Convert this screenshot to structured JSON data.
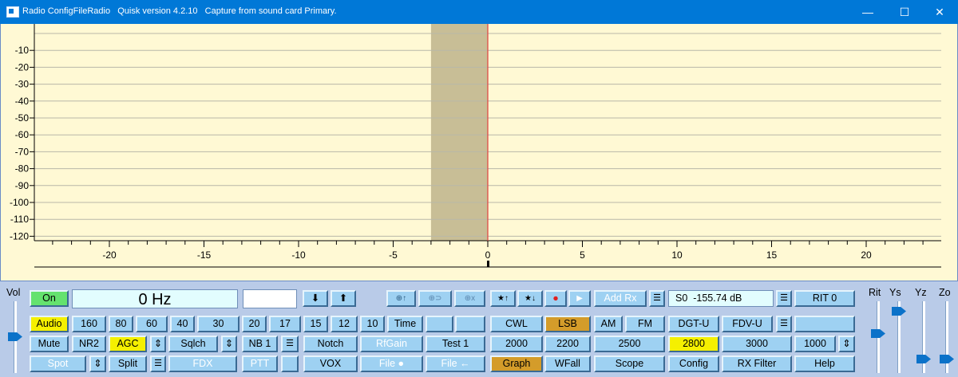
{
  "window": {
    "title": "Radio ConfigFileRadio   Quisk version 4.2.10   Capture from sound card Primary.",
    "minimize_label": "—",
    "maximize_label": "☐",
    "close_label": "✕"
  },
  "graph": {
    "y_ticks": [
      "-10",
      "-20",
      "-30",
      "-40",
      "-50",
      "-60",
      "-70",
      "-80",
      "-90",
      "-100",
      "-110",
      "-120"
    ],
    "x_ticks": [
      "-20",
      "-15",
      "-10",
      "-5",
      "0",
      "5",
      "10",
      "15",
      "20"
    ]
  },
  "colors": {
    "plot_background": "#fff9d4",
    "panel_background": "#b9cbe8",
    "button_blue": "#9ed1f2",
    "button_yellow": "#f5f000",
    "button_green": "#64e26e",
    "button_orange": "#d49c2a",
    "center_line": "#e04040",
    "filter_band": "#c8be96"
  },
  "panel": {
    "vol_label": "Vol",
    "rit_label": "Rit",
    "ys_label": "Ys",
    "yz_label": "Yz",
    "zo_label": "Zo",
    "frequency_display": "0 Hz",
    "smeter_display": "S0  -155.74 dB",
    "row1": {
      "on": "On",
      "down_arrow": "⬇",
      "up_arrow": "⬆",
      "mem_store": "⊕↑",
      "mem_recall": "⊕⊃",
      "mem_delete": "⊕x",
      "fav_store": "★↑",
      "fav_recall": "★↓",
      "record": "●",
      "play": "►",
      "add_rx": "Add Rx",
      "menu1": "☰",
      "menu2": "☰",
      "rit": "RIT 0"
    },
    "row2": {
      "audio": "Audio",
      "band_160": "160",
      "band_80": "80",
      "band_60": "60",
      "band_40": "40",
      "band_30": "30",
      "band_20": "20",
      "band_17": "17",
      "band_15": "15",
      "band_12": "12",
      "band_10": "10",
      "time": "Time",
      "cwl": "CWL",
      "lsb": "LSB",
      "am": "AM",
      "fm": "FM",
      "dgt": "DGT-U",
      "fdv": "FDV-U",
      "menu": "☰"
    },
    "row3": {
      "mute": "Mute",
      "nr2": "NR2",
      "agc": "AGC",
      "agc_adj": "⇕",
      "sqlch": "Sqlch",
      "sqlch_adj": "⇕",
      "nb": "NB 1",
      "nb_menu": "☰",
      "notch": "Notch",
      "rfgain": "RfGain",
      "test": "Test 1",
      "bw_2000": "2000",
      "bw_2200": "2200",
      "bw_2500": "2500",
      "bw_2800": "2800",
      "bw_3000": "3000",
      "bw_1000": "1000",
      "bw_adj": "⇕"
    },
    "row4": {
      "spot": "Spot",
      "spot_adj": "⇕",
      "split": "Split",
      "split_menu": "☰",
      "fdx": "FDX",
      "ptt": "PTT",
      "vox": "VOX",
      "file_rec": "File ●",
      "file_play": "File ←",
      "graph": "Graph",
      "wfall": "WFall",
      "scope": "Scope",
      "config": "Config",
      "rx_filter": "RX Filter",
      "help": "Help"
    },
    "sliders": {
      "vol": 0.45,
      "rit": 0.5,
      "ys": 0.85,
      "yz": 0.1,
      "zo": 0.1
    }
  }
}
